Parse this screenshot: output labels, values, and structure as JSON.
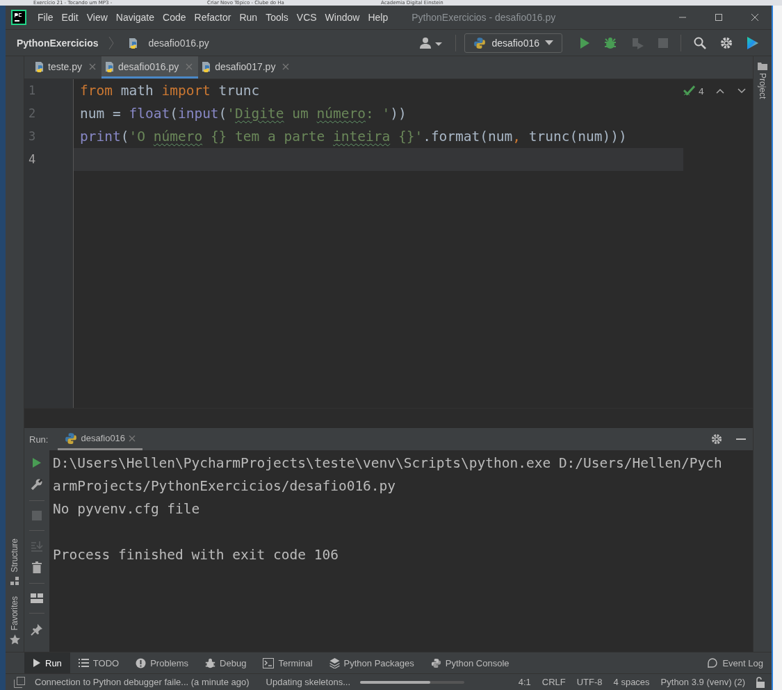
{
  "browser_tabs": [
    "Exercício 21 - Tocando um MP3 -",
    "Criar Novo Tópico - Clube do Ha",
    "Academia Digital Einstein"
  ],
  "menu": [
    "File",
    "Edit",
    "View",
    "Navigate",
    "Code",
    "Refactor",
    "Run",
    "Tools",
    "VCS",
    "Window",
    "Help"
  ],
  "window": {
    "title": "PythonExercicios - desafio016.py"
  },
  "breadcrumb": {
    "project": "PythonExercicios",
    "file": "desafio016.py"
  },
  "run_config": {
    "label": "desafio016"
  },
  "editor_tabs": [
    {
      "label": "teste.py",
      "selected": false
    },
    {
      "label": "desafio016.py",
      "selected": true
    },
    {
      "label": "desafio017.py",
      "selected": false
    }
  ],
  "inspection": {
    "count": "4"
  },
  "code_lines": [
    {
      "number": "1",
      "current": false,
      "tokens": [
        {
          "kind": "keyword",
          "text": "from"
        },
        {
          "kind": "plain",
          "text": " math "
        },
        {
          "kind": "keyword",
          "text": "import"
        },
        {
          "kind": "plain",
          "text": " trunc"
        }
      ]
    },
    {
      "number": "2",
      "current": false,
      "tokens": [
        {
          "kind": "plain",
          "text": "num = "
        },
        {
          "kind": "builtin",
          "text": "float"
        },
        {
          "kind": "plain",
          "text": "("
        },
        {
          "kind": "builtin",
          "text": "input"
        },
        {
          "kind": "plain",
          "text": "("
        },
        {
          "kind": "string",
          "text": "'"
        },
        {
          "kind": "typo",
          "text": "Digite"
        },
        {
          "kind": "string",
          "text": " um "
        },
        {
          "kind": "typo",
          "text": "número"
        },
        {
          "kind": "string",
          "text": ": '"
        },
        {
          "kind": "plain",
          "text": "))"
        }
      ]
    },
    {
      "number": "3",
      "current": false,
      "tokens": [
        {
          "kind": "builtin",
          "text": "print"
        },
        {
          "kind": "plain",
          "text": "("
        },
        {
          "kind": "string",
          "text": "'O "
        },
        {
          "kind": "typo",
          "text": "número"
        },
        {
          "kind": "string",
          "text": " {} tem a parte "
        },
        {
          "kind": "typo",
          "text": "inteira"
        },
        {
          "kind": "string",
          "text": " {}'"
        },
        {
          "kind": "plain",
          "text": ".format(num"
        },
        {
          "kind": "keyword",
          "text": ","
        },
        {
          "kind": "plain",
          "text": " trunc(num)))"
        }
      ]
    },
    {
      "number": "4",
      "current": true
    }
  ],
  "run_panel": {
    "label": "Run:",
    "tab": "desafio016",
    "output_blocks": [
      {
        "lines": [
          "D:\\Users\\Hellen\\PycharmProjects\\teste\\venv\\Scripts\\python.exe D:/Users/Hellen/Pych",
          "armProjects/PythonExercicios/desafio016.py",
          "No pyvenv.cfg file"
        ]
      },
      {
        "lines": [
          "Process finished with exit code 106"
        ]
      }
    ]
  },
  "left_stripe": [
    "Structure",
    "Favorites"
  ],
  "right_stripe": [
    "Project"
  ],
  "tool_tabs": [
    {
      "label": "Run",
      "kind": "run",
      "selected": true
    },
    {
      "label": "TODO",
      "kind": "todo",
      "selected": false
    },
    {
      "label": "Problems",
      "kind": "problems",
      "selected": false
    },
    {
      "label": "Debug",
      "kind": "debug",
      "selected": false
    },
    {
      "label": "Terminal",
      "kind": "terminal",
      "selected": false
    },
    {
      "label": "Python Packages",
      "kind": "packages",
      "selected": false
    },
    {
      "label": "Python Console",
      "kind": "console",
      "selected": false
    }
  ],
  "event_log": "Event Log",
  "status_bar": {
    "message": "Connection to Python debugger faile... (a minute ago)",
    "task": "Updating skeletons...",
    "level": 0.67,
    "items": [
      "4:1",
      "CRLF",
      "UTF-8",
      "4 spaces",
      "Python 3.9 (venv) (2)"
    ]
  }
}
